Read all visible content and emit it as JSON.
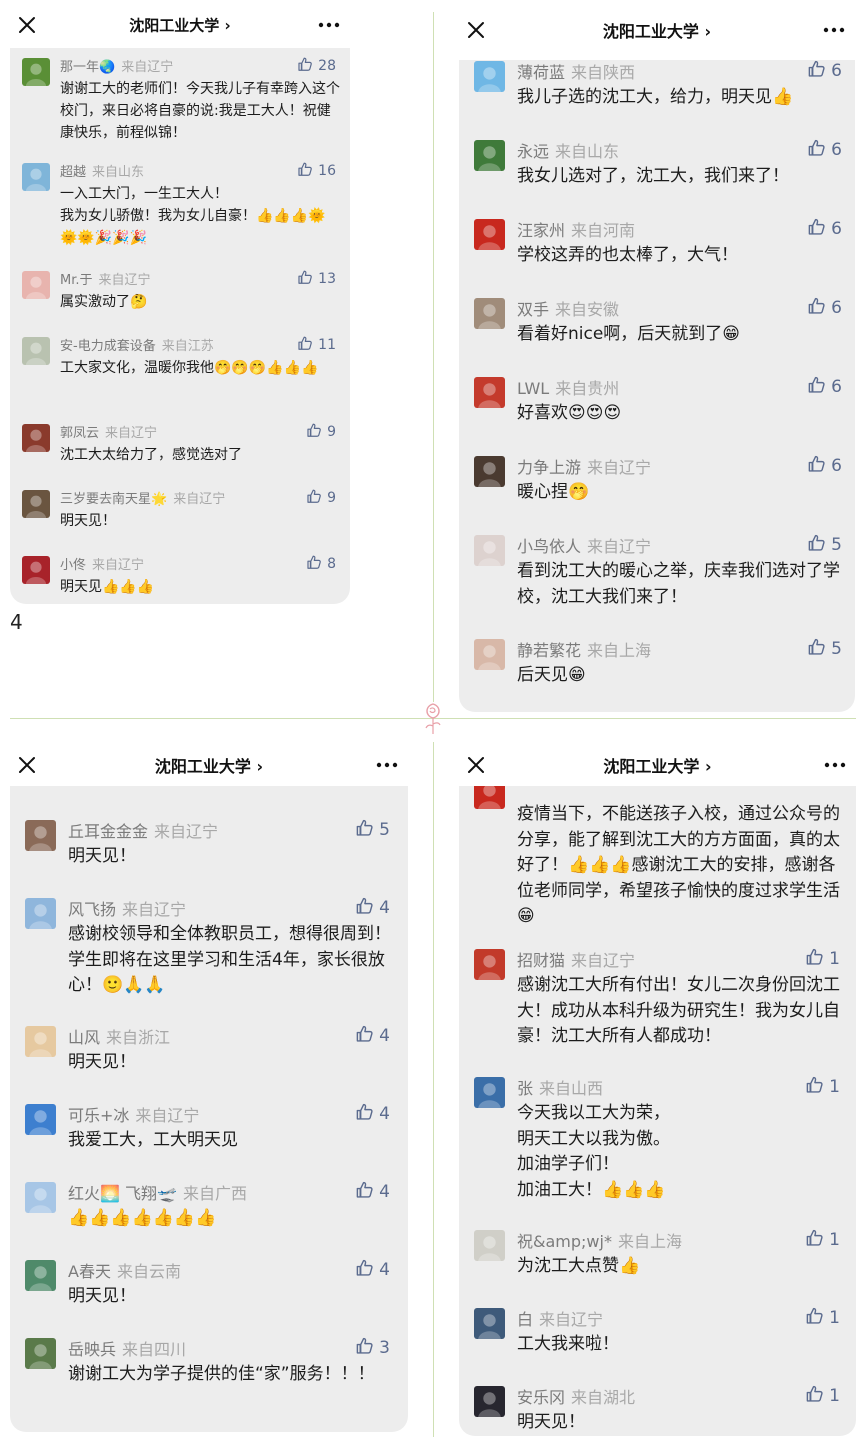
{
  "page_number": "4",
  "panels": [
    {
      "title": "沈阳工业大学 ›",
      "comments": [
        {
          "nick": "那一年🌏",
          "loc": "来自辽宁",
          "likes": "28",
          "text": "谢谢工大的老师们！今天我儿子有幸跨入这个校门，来日必将自豪的说:我是工大人！祝健康快乐，前程似锦！",
          "avatar": "#5a8f36"
        },
        {
          "nick": "超越",
          "loc": "来自山东",
          "likes": "16",
          "text": "一入工大门，一生工大人！\n我为女儿骄傲！我为女儿自豪！👍👍👍🌞🌞🌞🎉🎉🎉",
          "avatar": "#7fb5d9"
        },
        {
          "nick": "Mr.于",
          "loc": "来自辽宁",
          "likes": "13",
          "text": "属实激动了🤔",
          "avatar": "#e8b4ae"
        },
        {
          "nick": "安-电力成套设备",
          "loc": "来自江苏",
          "likes": "11",
          "text": "工大家文化，温暖你我他🤭🤭🤭👍👍👍",
          "avatar": "#b9c2b0"
        },
        {
          "nick": "郭凤云",
          "loc": "来自辽宁",
          "likes": "9",
          "text": "沈工大太给力了，感觉选对了",
          "avatar": "#8a3a2c"
        },
        {
          "nick": "三岁要去南天星🌟",
          "loc": "来自辽宁",
          "likes": "9",
          "text": "明天见！",
          "avatar": "#6a5540"
        },
        {
          "nick": "小佟",
          "loc": "来自辽宁",
          "likes": "8",
          "text": "明天见👍👍👍",
          "avatar": "#a8232a"
        }
      ]
    },
    {
      "title": "沈阳工业大学 ›",
      "comments": [
        {
          "nick": "薄荷蓝",
          "loc": "来自陕西",
          "likes": "6",
          "text": "我儿子选的沈工大，给力，明天见👍",
          "avatar": "#6fb7e5"
        },
        {
          "nick": "永远",
          "loc": "来自山东",
          "likes": "6",
          "text": "我女儿选对了，沈工大，我们来了！",
          "avatar": "#3f7a3a"
        },
        {
          "nick": "汪家州",
          "loc": "来自河南",
          "likes": "6",
          "text": "学校这弄的也太棒了，大气！",
          "avatar": "#c8281e"
        },
        {
          "nick": "双手",
          "loc": "来自安徽",
          "likes": "6",
          "text": "看着好nice啊，后天就到了😁",
          "avatar": "#a08c7a"
        },
        {
          "nick": "LWL",
          "loc": "来自贵州",
          "likes": "6",
          "text": "好喜欢😍😍😍",
          "avatar": "#c43a2c"
        },
        {
          "nick": "力争上游",
          "loc": "来自辽宁",
          "likes": "6",
          "text": "暖心捏🤭",
          "avatar": "#4a3a30"
        },
        {
          "nick": "小鸟依人",
          "loc": "来自辽宁",
          "likes": "5",
          "text": "看到沈工大的暖心之举，庆幸我们选对了学校，沈工大我们来了！",
          "avatar": "#ddd2cf"
        },
        {
          "nick": "静若繁花",
          "loc": "来自上海",
          "likes": "5",
          "text": "后天见😁",
          "avatar": "#d8b8a8"
        }
      ]
    },
    {
      "title": "沈阳工业大学 ›",
      "comments": [
        {
          "nick": "丘耳金金金",
          "loc": "来自辽宁",
          "likes": "5",
          "text": "明天见！",
          "avatar": "#8a6a58"
        },
        {
          "nick": "风飞扬",
          "loc": "来自辽宁",
          "likes": "4",
          "text": "感谢校领导和全体教职员工，想得很周到！学生即将在这里学习和生活4年，家长很放心！🙂🙏🙏",
          "avatar": "#8fb6dc"
        },
        {
          "nick": "山风",
          "loc": "来自浙江",
          "likes": "4",
          "text": "明天见！",
          "avatar": "#e6c9a0"
        },
        {
          "nick": "可乐+冰",
          "loc": "来自辽宁",
          "likes": "4",
          "text": "我爱工大，工大明天见",
          "avatar": "#3d7fcf"
        },
        {
          "nick": "红火🌅 飞翔🛫",
          "loc": "来自广西",
          "likes": "4",
          "text": "👍👍👍👍👍👍👍",
          "avatar": "#a7c6e6"
        },
        {
          "nick": "A春天",
          "loc": "来自云南",
          "likes": "4",
          "text": "明天见！",
          "avatar": "#4f8a6a"
        },
        {
          "nick": "岳映兵",
          "loc": "来自四川",
          "likes": "3",
          "text": "谢谢工大为学子提供的佳“家”服务！！！",
          "avatar": "#5a7a4a"
        }
      ]
    },
    {
      "title": "沈阳工业大学 ›",
      "comments": [
        {
          "nick": "",
          "loc": "",
          "likes": "",
          "text": "疫情当下，不能送孩子入校，通过公众号的分享，能了解到沈工大的方方面面，真的太好了！👍👍👍感谢沈工大的安排，感谢各位老师同学，希望孩子愉快的度过求学生活😁",
          "avatar": "#c8281e"
        },
        {
          "nick": "招财猫",
          "loc": "来自辽宁",
          "likes": "1",
          "text": "感谢沈工大所有付出！女儿二次身份回沈工大！成功从本科升级为研究生！我为女儿自豪！沈工大所有人都成功！",
          "avatar": "#c23a2a"
        },
        {
          "nick": "张",
          "loc": "来自山西",
          "likes": "1",
          "text": "今天我以工大为荣，\n明天工大以我为傲。\n加油学子们！\n加油工大！👍👍👍",
          "avatar": "#3a6ea8"
        },
        {
          "nick": "祝&amp;wj*",
          "loc": "来自上海",
          "likes": "1",
          "text": "为沈工大点赞👍",
          "avatar": "#d0cfc8"
        },
        {
          "nick": "白",
          "loc": "来自辽宁",
          "likes": "1",
          "text": "工大我来啦！",
          "avatar": "#3e5a7a"
        },
        {
          "nick": "安乐冈",
          "loc": "来自湖北",
          "likes": "1",
          "text": "明天见！",
          "avatar": "#27262f"
        }
      ]
    }
  ]
}
